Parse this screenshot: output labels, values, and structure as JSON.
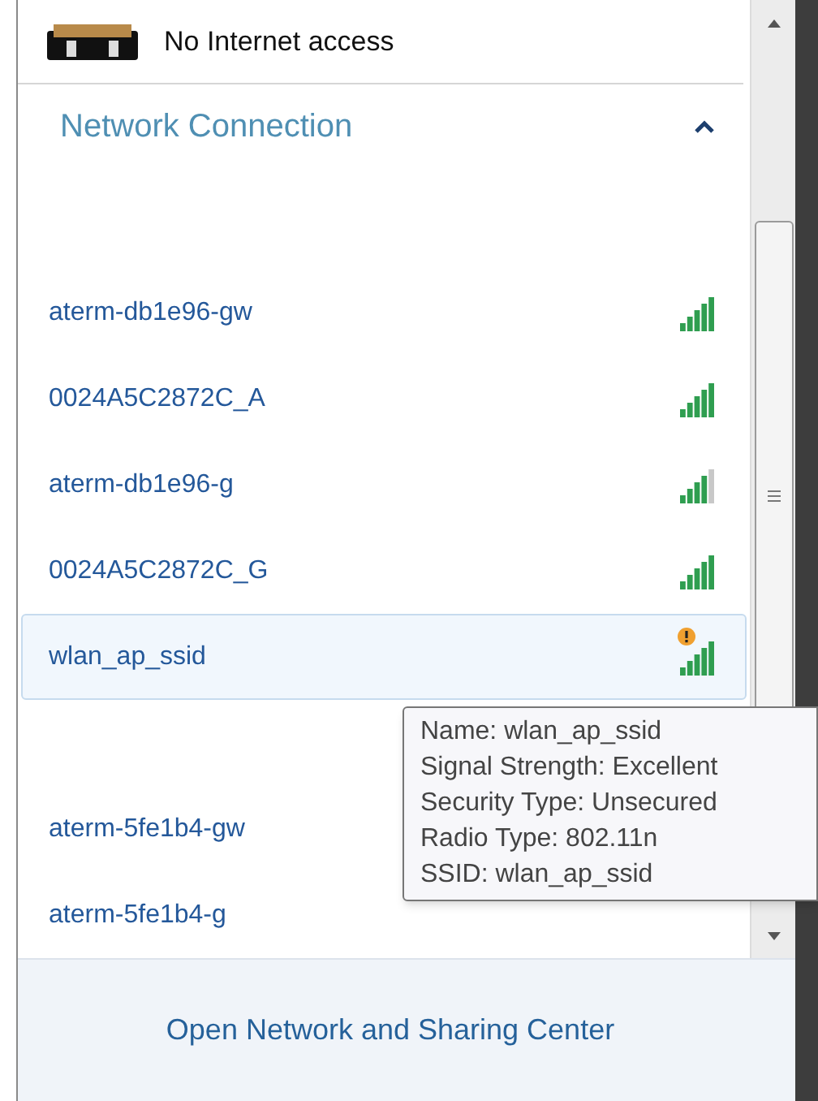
{
  "status": {
    "text": "No Internet access"
  },
  "section": {
    "title": "Network Connection",
    "expanded": true
  },
  "networks": [
    {
      "name": "aterm-db1e96-gw",
      "kind": "full",
      "warning": false,
      "selected": false
    },
    {
      "name": "0024A5C2872C_A",
      "kind": "full",
      "warning": false,
      "selected": false
    },
    {
      "name": "aterm-db1e96-g",
      "kind": "partial",
      "warning": false,
      "selected": false
    },
    {
      "name": "0024A5C2872C_G",
      "kind": "full",
      "warning": false,
      "selected": false
    },
    {
      "name": "wlan_ap_ssid",
      "kind": "full",
      "warning": true,
      "selected": true
    }
  ],
  "more_networks": [
    {
      "name": "aterm-5fe1b4-gw",
      "selected": false
    },
    {
      "name": "aterm-5fe1b4-g",
      "selected": false
    }
  ],
  "tooltip": {
    "lines": [
      "Name: wlan_ap_ssid",
      "Signal Strength: Excellent",
      "Security Type: Unsecured",
      "Radio Type: 802.11n",
      "SSID: wlan_ap_ssid"
    ]
  },
  "footer": {
    "link": "Open Network and Sharing Center"
  }
}
